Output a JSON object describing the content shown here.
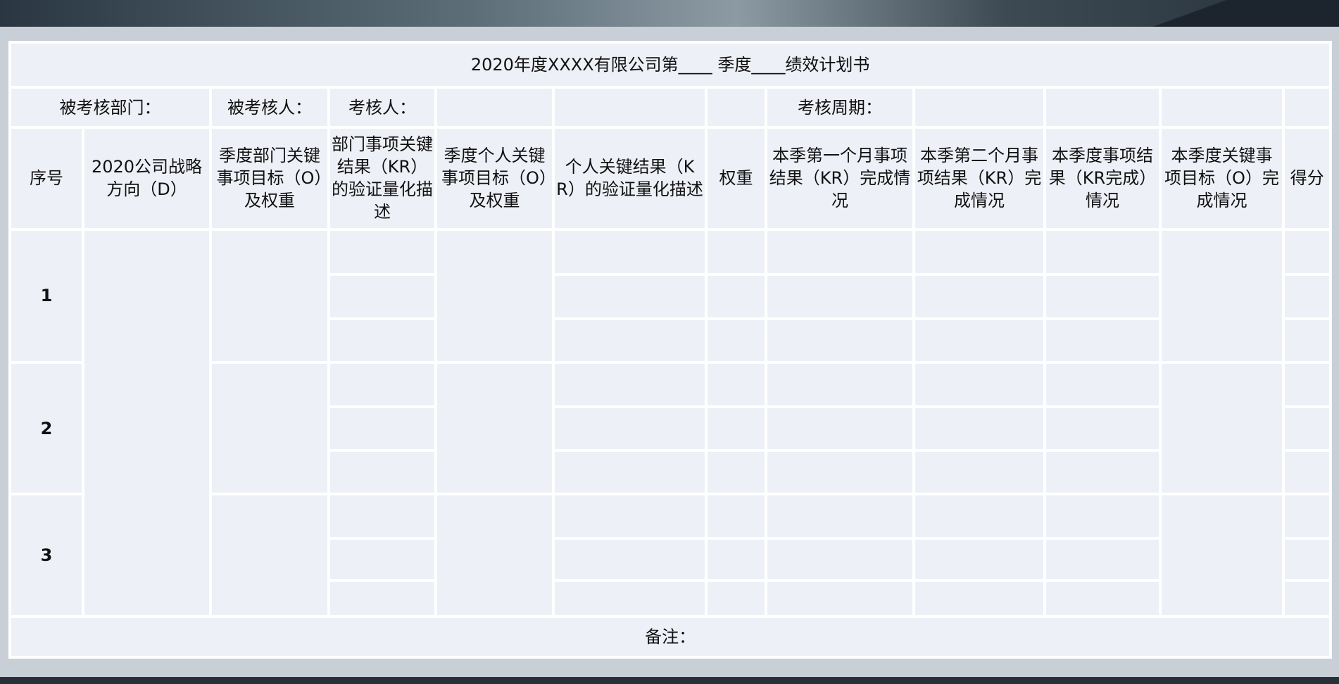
{
  "title": "2020年度XXXX有限公司第____ 季度____绩效计划书",
  "info": {
    "dept": "被考核部门：",
    "assessee": "被考核人：",
    "assessor": "考核人：",
    "period": "考核周期："
  },
  "headers": {
    "seq": "序号",
    "strategy": "2020公司战略方向（D）",
    "dept_obj": "季度部门关键事项目标（O）及权重",
    "dept_kr": "部门事项关键结果（KR）的验证量化描述",
    "indiv_obj": "季度个人关键事项目标（O）及权重",
    "indiv_kr": "个人关键结果（KR）的验证量化描述",
    "weight": "权重",
    "m1": "本季第一个月事项结果（KR）完成情况",
    "m2": "本季第二个月事项结果（KR）完成情况",
    "quarter_kr": "本季度事项结果（KR完成）情况",
    "quarter_o": "本季度关键事项目标（O）完成情况",
    "score": "得分"
  },
  "rows": [
    "1",
    "2",
    "3"
  ],
  "remark": "备注："
}
